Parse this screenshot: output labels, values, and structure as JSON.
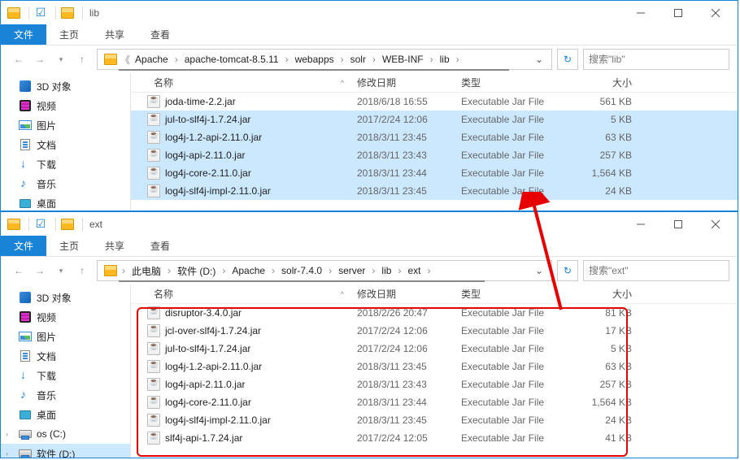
{
  "win1": {
    "title": "lib",
    "ribbon": [
      "文件",
      "主页",
      "共享",
      "查看"
    ],
    "crumbs": [
      "Apache",
      "apache-tomcat-8.5.11",
      "webapps",
      "solr",
      "WEB-INF",
      "lib"
    ],
    "search_ph": "搜索\"lib\"",
    "cols": {
      "name": "名称",
      "date": "修改日期",
      "type": "类型",
      "size": "大小"
    },
    "sidebar": [
      {
        "label": "3D 对象",
        "icon": "ico-3d",
        "caret": ""
      },
      {
        "label": "视频",
        "icon": "ico-video",
        "caret": ""
      },
      {
        "label": "图片",
        "icon": "ico-pic",
        "caret": ""
      },
      {
        "label": "文档",
        "icon": "ico-doc",
        "caret": ""
      },
      {
        "label": "下载",
        "icon": "ico-dl",
        "caret": ""
      },
      {
        "label": "音乐",
        "icon": "ico-music",
        "caret": ""
      },
      {
        "label": "桌面",
        "icon": "ico-desktop",
        "caret": ""
      }
    ],
    "files": [
      {
        "name": "joda-time-2.2.jar",
        "date": "2018/6/18 16:55",
        "type": "Executable Jar File",
        "size": "561 KB",
        "sel": false
      },
      {
        "name": "jul-to-slf4j-1.7.24.jar",
        "date": "2017/2/24 12:06",
        "type": "Executable Jar File",
        "size": "5 KB",
        "sel": true
      },
      {
        "name": "log4j-1.2-api-2.11.0.jar",
        "date": "2018/3/11 23:45",
        "type": "Executable Jar File",
        "size": "63 KB",
        "sel": true
      },
      {
        "name": "log4j-api-2.11.0.jar",
        "date": "2018/3/11 23:43",
        "type": "Executable Jar File",
        "size": "257 KB",
        "sel": true
      },
      {
        "name": "log4j-core-2.11.0.jar",
        "date": "2018/3/11 23:44",
        "type": "Executable Jar File",
        "size": "1,564 KB",
        "sel": true
      },
      {
        "name": "log4j-slf4j-impl-2.11.0.jar",
        "date": "2018/3/11 23:45",
        "type": "Executable Jar File",
        "size": "24 KB",
        "sel": true
      }
    ]
  },
  "win2": {
    "title": "ext",
    "ribbon": [
      "文件",
      "主页",
      "共享",
      "查看"
    ],
    "crumbs": [
      "此电脑",
      "软件 (D:)",
      "Apache",
      "solr-7.4.0",
      "server",
      "lib",
      "ext"
    ],
    "search_ph": "搜索\"ext\"",
    "cols": {
      "name": "名称",
      "date": "修改日期",
      "type": "类型",
      "size": "大小"
    },
    "sidebar": [
      {
        "label": "3D 对象",
        "icon": "ico-3d"
      },
      {
        "label": "视频",
        "icon": "ico-video"
      },
      {
        "label": "图片",
        "icon": "ico-pic"
      },
      {
        "label": "文档",
        "icon": "ico-doc"
      },
      {
        "label": "下载",
        "icon": "ico-dl"
      },
      {
        "label": "音乐",
        "icon": "ico-music"
      },
      {
        "label": "桌面",
        "icon": "ico-desktop"
      },
      {
        "label": "os (C:)",
        "icon": "ico-drive",
        "caret": "›"
      },
      {
        "label": "软件 (D:)",
        "icon": "ico-drive",
        "caret": "›",
        "sel": true
      }
    ],
    "files": [
      {
        "name": "disruptor-3.4.0.jar",
        "date": "2018/2/26 20:47",
        "type": "Executable Jar File",
        "size": "81 KB"
      },
      {
        "name": "jcl-over-slf4j-1.7.24.jar",
        "date": "2017/2/24 12:06",
        "type": "Executable Jar File",
        "size": "17 KB"
      },
      {
        "name": "jul-to-slf4j-1.7.24.jar",
        "date": "2017/2/24 12:06",
        "type": "Executable Jar File",
        "size": "5 KB"
      },
      {
        "name": "log4j-1.2-api-2.11.0.jar",
        "date": "2018/3/11 23:45",
        "type": "Executable Jar File",
        "size": "63 KB"
      },
      {
        "name": "log4j-api-2.11.0.jar",
        "date": "2018/3/11 23:43",
        "type": "Executable Jar File",
        "size": "257 KB"
      },
      {
        "name": "log4j-core-2.11.0.jar",
        "date": "2018/3/11 23:44",
        "type": "Executable Jar File",
        "size": "1,564 KB"
      },
      {
        "name": "log4j-slf4j-impl-2.11.0.jar",
        "date": "2018/3/11 23:45",
        "type": "Executable Jar File",
        "size": "24 KB"
      },
      {
        "name": "slf4j-api-1.7.24.jar",
        "date": "2017/2/24 12:05",
        "type": "Executable Jar File",
        "size": "41 KB"
      }
    ]
  }
}
